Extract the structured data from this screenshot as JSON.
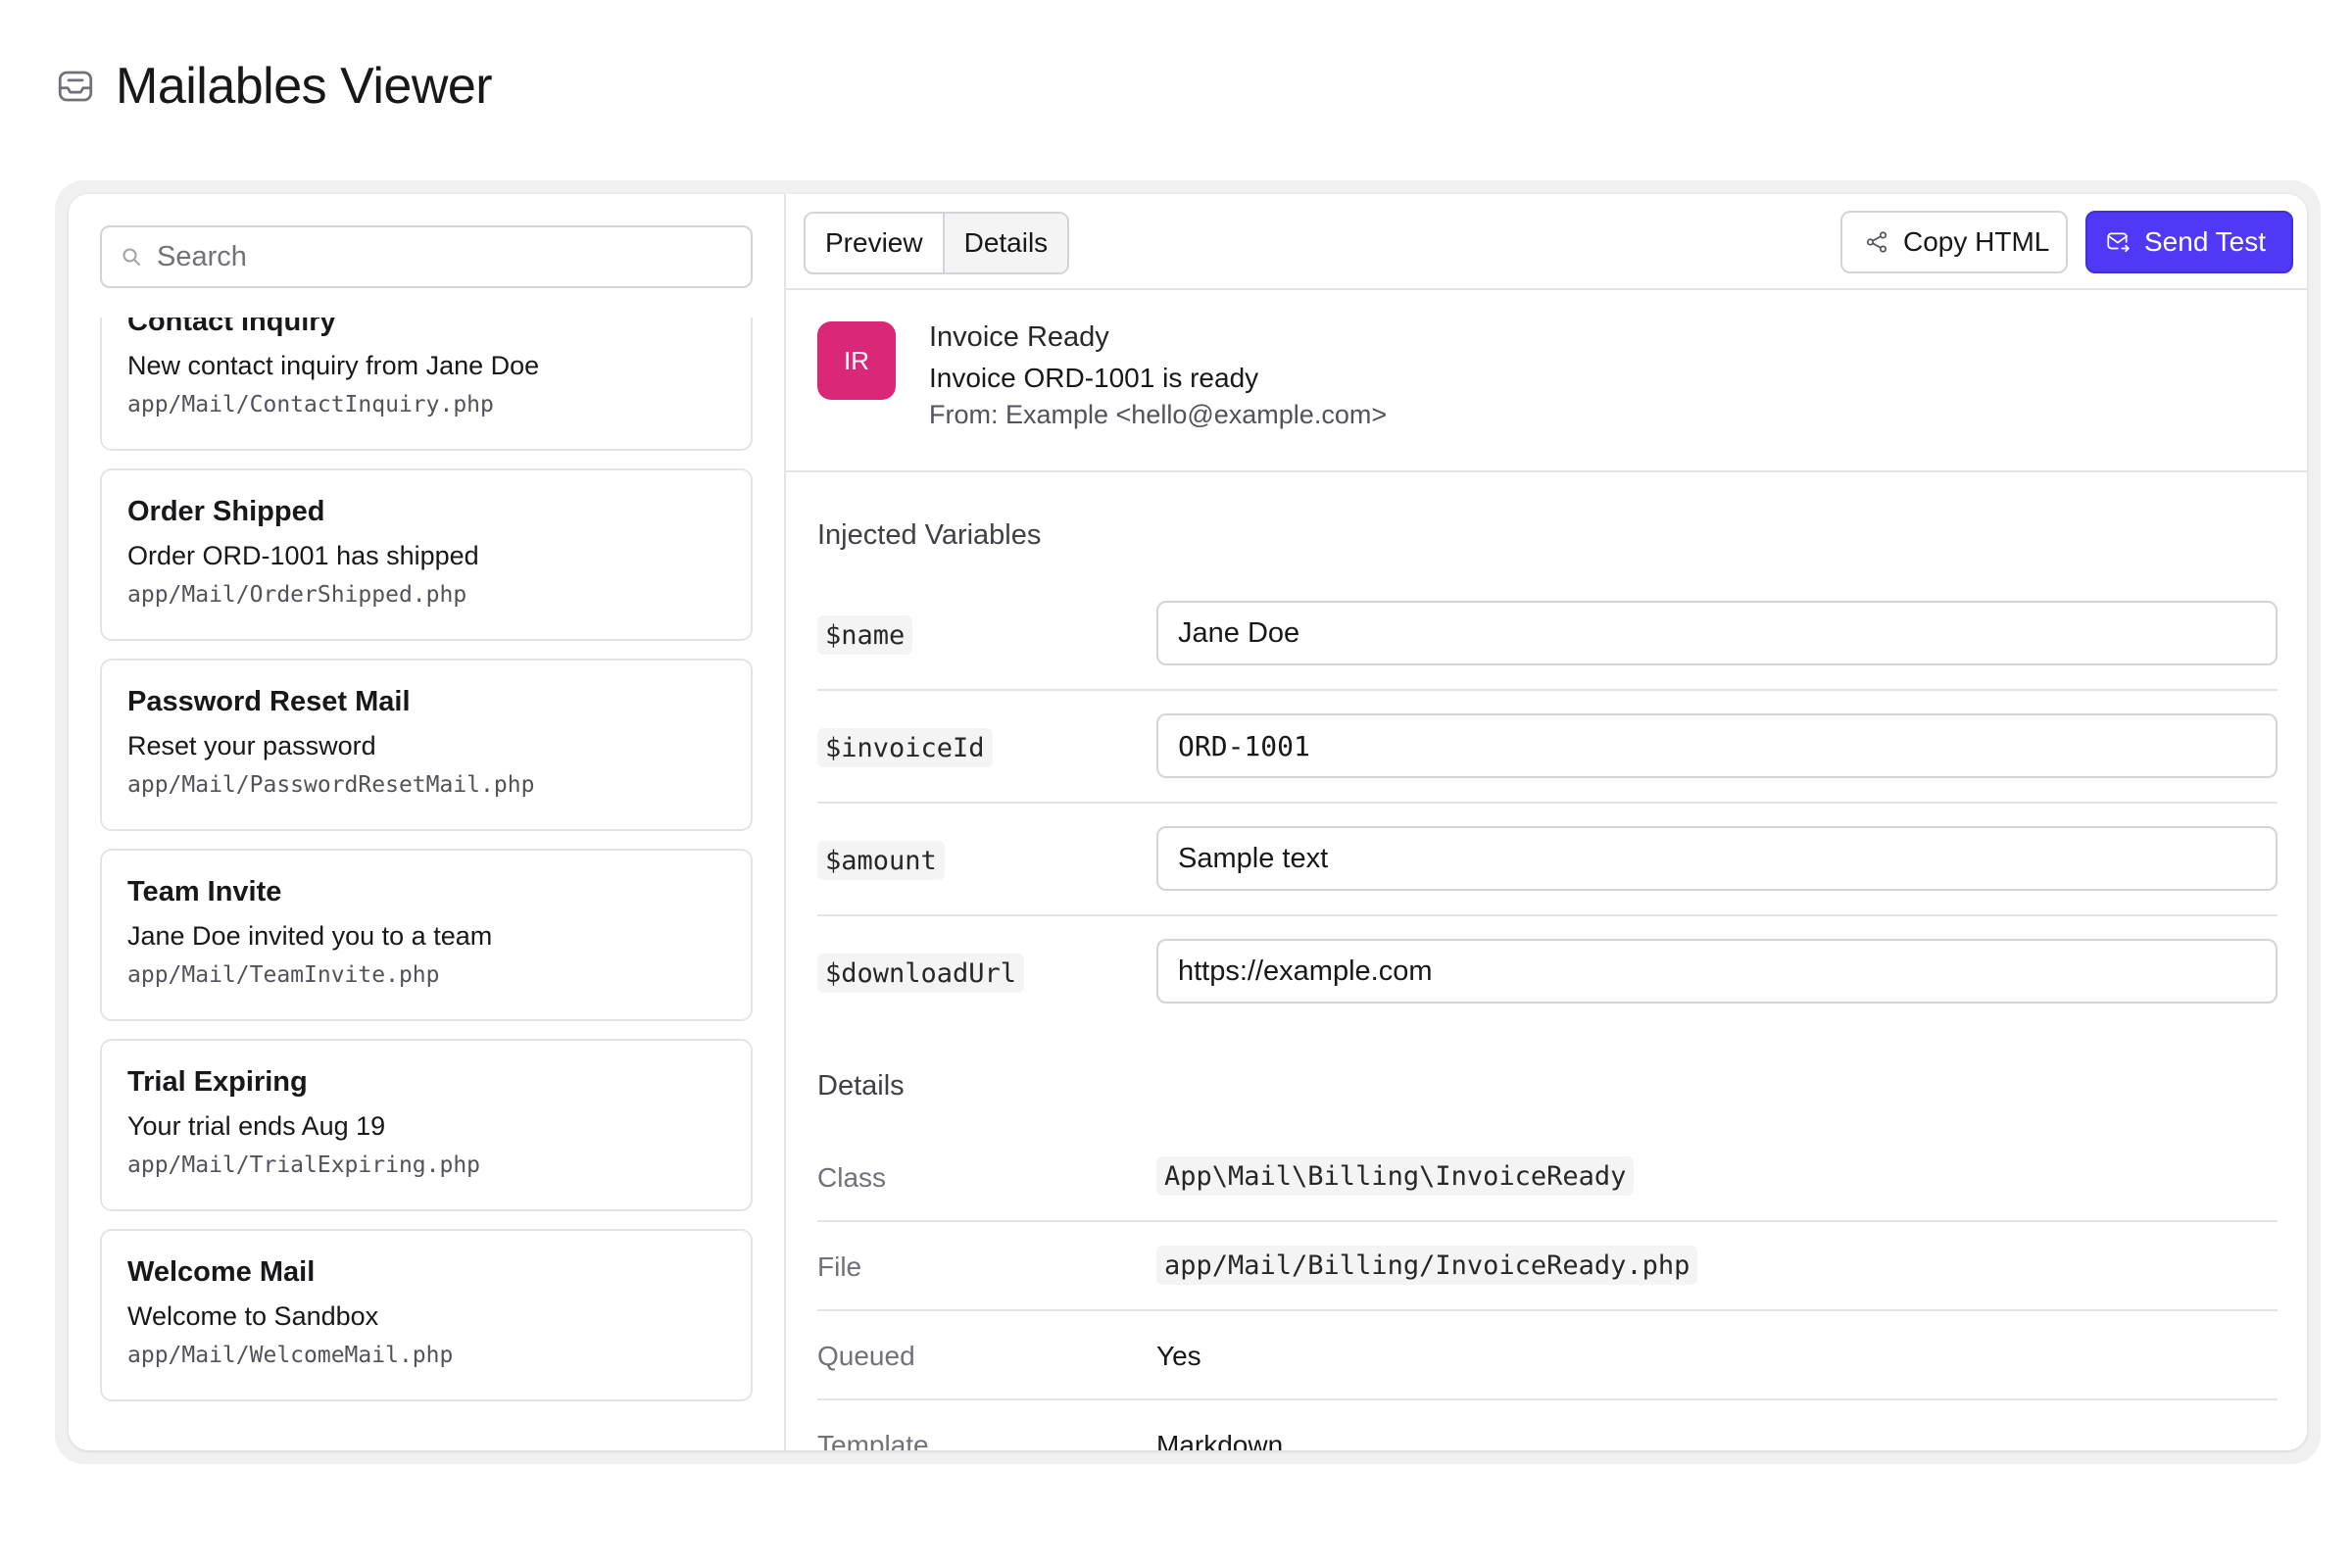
{
  "page": {
    "title": "Mailables Viewer",
    "logo_icon": "inbox-icon"
  },
  "sidebar": {
    "search_placeholder": "Search",
    "items": [
      {
        "title": "Contact Inquiry",
        "subject": "New contact inquiry from Jane Doe",
        "path": "app/Mail/ContactInquiry.php"
      },
      {
        "title": "Order Shipped",
        "subject": "Order ORD-1001 has shipped",
        "path": "app/Mail/OrderShipped.php"
      },
      {
        "title": "Password Reset Mail",
        "subject": "Reset your password",
        "path": "app/Mail/PasswordResetMail.php"
      },
      {
        "title": "Team Invite",
        "subject": "Jane Doe invited you to a team",
        "path": "app/Mail/TeamInvite.php"
      },
      {
        "title": "Trial Expiring",
        "subject": "Your trial ends Aug 19",
        "path": "app/Mail/TrialExpiring.php"
      },
      {
        "title": "Welcome Mail",
        "subject": "Welcome to Sandbox",
        "path": "app/Mail/WelcomeMail.php"
      }
    ]
  },
  "toolbar": {
    "tabs": [
      {
        "label": "Preview",
        "active": false
      },
      {
        "label": "Details",
        "active": true
      }
    ],
    "copy_label": "Copy HTML",
    "send_label": "Send Test",
    "accent_color": "#4f39f6"
  },
  "mail": {
    "avatar_initials": "IR",
    "avatar_color": "#db2777",
    "name": "Invoice Ready",
    "subject": "Invoice ORD-1001 is ready",
    "from": "From: Example <hello@example.com>"
  },
  "variables": {
    "title": "Injected Variables",
    "rows": [
      {
        "key": "$name",
        "value": "Jane Doe"
      },
      {
        "key": "$invoiceId",
        "value": "ORD-1001"
      },
      {
        "key": "$amount",
        "value": "Sample text"
      },
      {
        "key": "$downloadUrl",
        "value": "https://example.com"
      }
    ]
  },
  "details": {
    "title": "Details",
    "rows": [
      {
        "label": "Class",
        "value": "App\\Mail\\Billing\\InvoiceReady"
      },
      {
        "label": "File",
        "value": "app/Mail/Billing/InvoiceReady.php"
      },
      {
        "label": "Queued",
        "value": "Yes"
      },
      {
        "label": "Template",
        "value": "Markdown"
      }
    ]
  }
}
